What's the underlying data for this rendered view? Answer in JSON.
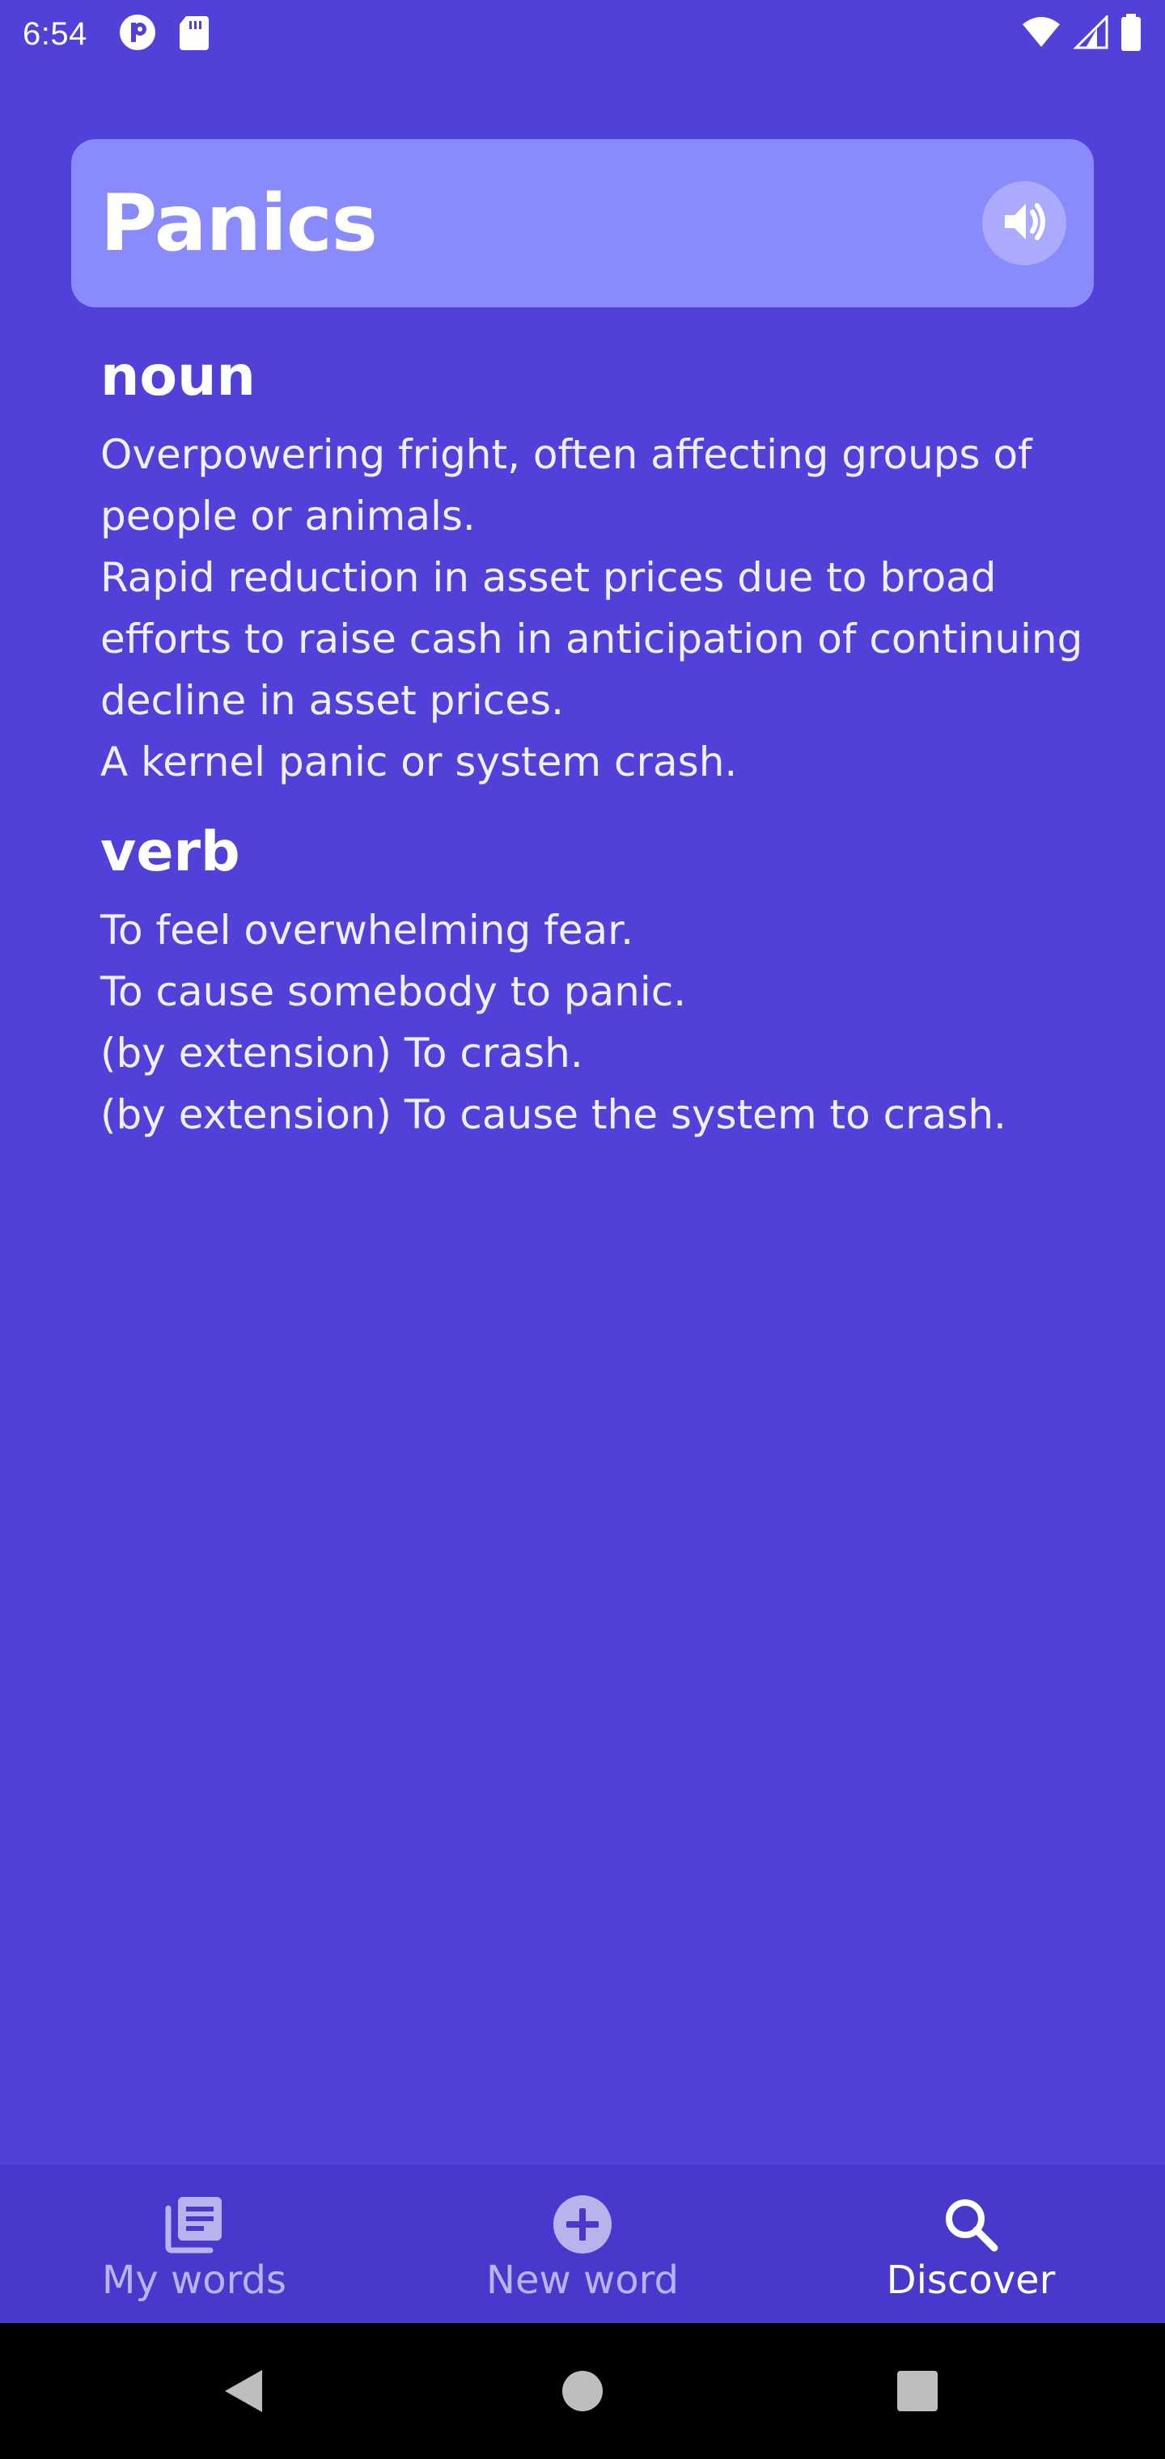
{
  "status_bar": {
    "time": "6:54",
    "icons_left": [
      "notification-p-icon",
      "sd-card-icon"
    ],
    "icons_right": [
      "wifi-icon",
      "cell-signal-icon",
      "battery-icon"
    ]
  },
  "word_card": {
    "word": "Panics",
    "speaker_icon": "volume-icon",
    "background": "#8a8aff"
  },
  "definitions": [
    {
      "part_of_speech": "noun",
      "items": [
        "Overpowering fright, often affecting groups of people or animals.",
        "Rapid reduction in asset prices due to broad efforts to raise cash in anticipation of continuing decline in asset prices.",
        "A kernel panic or system crash."
      ]
    },
    {
      "part_of_speech": "verb",
      "items": [
        "To feel overwhelming fear.",
        "To cause somebody to panic.",
        "(by extension) To crash.",
        "(by extension) To cause the system to crash."
      ]
    }
  ],
  "bottom_nav": {
    "items": [
      {
        "label": "My words",
        "icon": "library-icon",
        "active": false
      },
      {
        "label": "New word",
        "icon": "add-circle-icon",
        "active": true
      },
      {
        "label": "Discover",
        "icon": "search-icon",
        "active": false
      }
    ]
  },
  "system_nav": {
    "icons": [
      "back-icon",
      "home-icon",
      "recents-icon"
    ]
  },
  "colors": {
    "background": "#5141d9",
    "card": "#8a8aff",
    "nav_bar": "#4838cc",
    "system_nav": "#000000"
  }
}
